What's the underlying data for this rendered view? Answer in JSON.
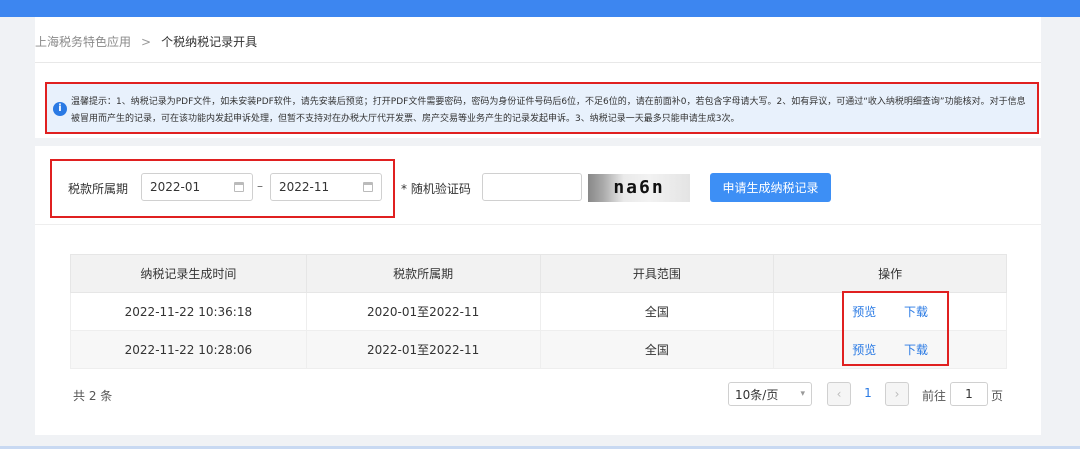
{
  "breadcrumb": {
    "parent": "上海税务特色应用",
    "separator": ">",
    "current": "个税纳税记录开具"
  },
  "notice": {
    "icon": "info-icon",
    "text": "温馨提示：1、纳税记录为PDF文件，如未安装PDF软件，请先安装后预览；打开PDF文件需要密码，密码为身份证件号码后6位，不足6位的，请在前面补0，若包含字母请大写。2、如有异议，可通过“收入纳税明细查询”功能核对。对于信息被冒用而产生的记录，可在该功能内发起申诉处理，但暂不支持对在办税大厅代开发票、房产交易等业务产生的记录发起申诉。3、纳税记录一天最多只能申请生成3次。"
  },
  "form": {
    "period_label": "税款所属期",
    "start_date": "2022-01",
    "end_date": "2022-11",
    "range_separator": "–",
    "captcha_label": "* 随机验证码",
    "captcha_value": "",
    "captcha_image_text": "na6n",
    "submit_label": "申请生成纳税记录"
  },
  "table": {
    "headers": [
      "纳税记录生成时间",
      "税款所属期",
      "开具范围",
      "操作"
    ],
    "rows": [
      {
        "time": "2022-11-22 10:36:18",
        "period": "2020-01至2022-11",
        "scope": "全国",
        "preview": "预览",
        "download": "下载"
      },
      {
        "time": "2022-11-22 10:28:06",
        "period": "2022-01至2022-11",
        "scope": "全国",
        "preview": "预览",
        "download": "下载"
      }
    ]
  },
  "pagination": {
    "total": "共 2 条",
    "page_size": "10条/页",
    "prev": "‹",
    "current_page": "1",
    "next": "›",
    "goto_label": "前往",
    "goto_value": "1",
    "page_unit": "页"
  },
  "colors": {
    "accent": "#3d8ff5",
    "link": "#2a7ae4",
    "highlight_border": "#e02020"
  }
}
